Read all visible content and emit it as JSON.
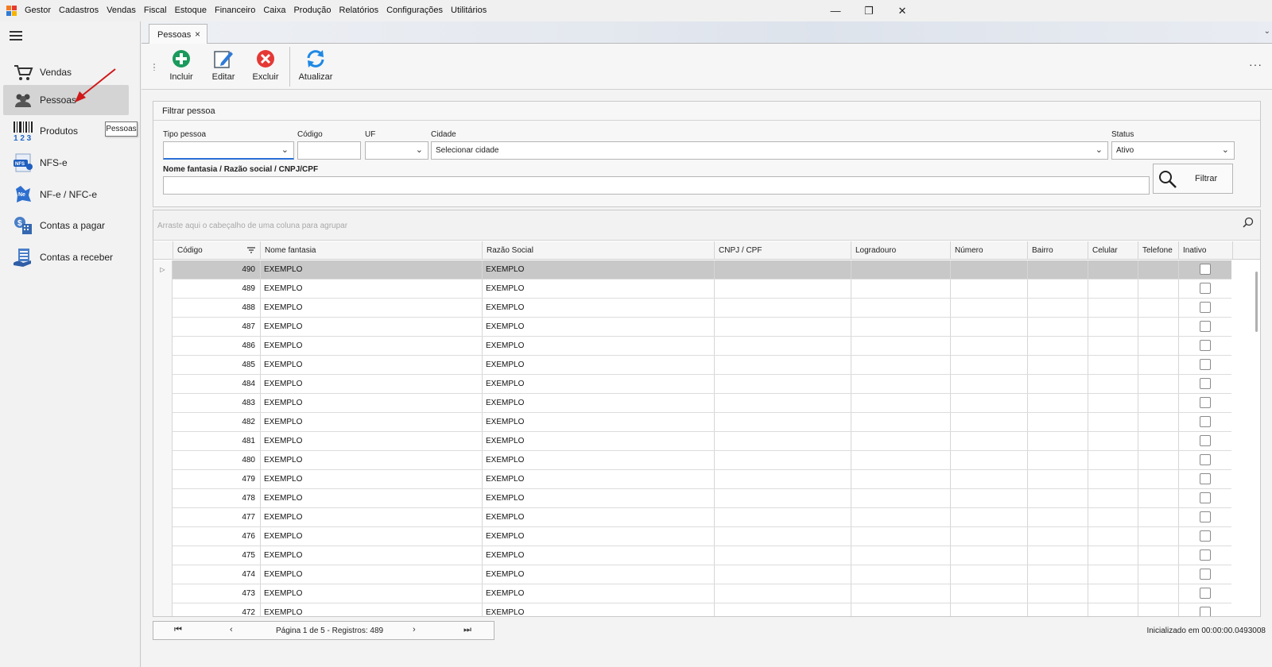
{
  "menubar": {
    "app_name": "Gestor",
    "items": [
      "Cadastros",
      "Vendas",
      "Fiscal",
      "Estoque",
      "Financeiro",
      "Caixa",
      "Produção",
      "Relatórios",
      "Configurações",
      "Utilitários"
    ]
  },
  "window_controls": {
    "minimize": "—",
    "restore": "❐",
    "close": "✕"
  },
  "sidebar": {
    "items": [
      {
        "label": "Vendas",
        "icon": "cart-icon"
      },
      {
        "label": "Pessoas",
        "icon": "people-icon",
        "active": true
      },
      {
        "label": "Produtos",
        "icon": "barcode-icon"
      },
      {
        "label": "NFS-e",
        "icon": "nfse-icon"
      },
      {
        "label": "NF-e / NFC-e",
        "icon": "nfe-icon"
      },
      {
        "label": "Contas a pagar",
        "icon": "payables-icon"
      },
      {
        "label": "Contas a receber",
        "icon": "receivables-icon"
      }
    ],
    "tooltip": "Pessoas"
  },
  "tabs": {
    "active_label": "Pessoas",
    "close": "×"
  },
  "toolbar": {
    "incluir": "Incluir",
    "editar": "Editar",
    "excluir": "Excluir",
    "atualizar": "Atualizar",
    "more": "···"
  },
  "filter": {
    "title": "Filtrar pessoa",
    "tipo_pessoa_label": "Tipo pessoa",
    "tipo_pessoa_value": "",
    "codigo_label": "Código",
    "codigo_value": "",
    "uf_label": "UF",
    "uf_value": "",
    "cidade_label": "Cidade",
    "cidade_value": "Selecionar cidade",
    "status_label": "Status",
    "status_value": "Ativo",
    "nome_label": "Nome fantasia / Razão social / CNPJ/CPF",
    "nome_value": "",
    "filtrar_label": "Filtrar"
  },
  "grid": {
    "group_hint": "Arraste aqui o cabeçalho de uma coluna para agrupar",
    "columns": [
      "Código",
      "Nome fantasia",
      "Razão Social",
      "CNPJ / CPF",
      "Logradouro",
      "Número",
      "Bairro",
      "Celular",
      "Telefone",
      "Inativo"
    ],
    "rows": [
      {
        "codigo": "490",
        "nome": "EXEMPLO",
        "razao": "EXEMPLO"
      },
      {
        "codigo": "489",
        "nome": "EXEMPLO",
        "razao": "EXEMPLO"
      },
      {
        "codigo": "488",
        "nome": "EXEMPLO",
        "razao": "EXEMPLO"
      },
      {
        "codigo": "487",
        "nome": "EXEMPLO",
        "razao": "EXEMPLO"
      },
      {
        "codigo": "486",
        "nome": "EXEMPLO",
        "razao": "EXEMPLO"
      },
      {
        "codigo": "485",
        "nome": "EXEMPLO",
        "razao": "EXEMPLO"
      },
      {
        "codigo": "484",
        "nome": "EXEMPLO",
        "razao": "EXEMPLO"
      },
      {
        "codigo": "483",
        "nome": "EXEMPLO",
        "razao": "EXEMPLO"
      },
      {
        "codigo": "482",
        "nome": "EXEMPLO",
        "razao": "EXEMPLO"
      },
      {
        "codigo": "481",
        "nome": "EXEMPLO",
        "razao": "EXEMPLO"
      },
      {
        "codigo": "480",
        "nome": "EXEMPLO",
        "razao": "EXEMPLO"
      },
      {
        "codigo": "479",
        "nome": "EXEMPLO",
        "razao": "EXEMPLO"
      },
      {
        "codigo": "478",
        "nome": "EXEMPLO",
        "razao": "EXEMPLO"
      },
      {
        "codigo": "477",
        "nome": "EXEMPLO",
        "razao": "EXEMPLO"
      },
      {
        "codigo": "476",
        "nome": "EXEMPLO",
        "razao": "EXEMPLO"
      },
      {
        "codigo": "475",
        "nome": "EXEMPLO",
        "razao": "EXEMPLO"
      },
      {
        "codigo": "474",
        "nome": "EXEMPLO",
        "razao": "EXEMPLO"
      },
      {
        "codigo": "473",
        "nome": "EXEMPLO",
        "razao": "EXEMPLO"
      },
      {
        "codigo": "472",
        "nome": "EXEMPLO",
        "razao": "EXEMPLO"
      }
    ]
  },
  "pager": {
    "first": "⏮",
    "prev": "‹",
    "info": "Página 1 de 5 - Registros: 489",
    "next": "›",
    "last": "⏭"
  },
  "status": {
    "text": "Inicializado em 00:00:00.0493008"
  },
  "colors": {
    "accent": "#2a6fd6",
    "add": "#1a9a5c",
    "delete": "#e53935",
    "refresh": "#1e88e5"
  }
}
